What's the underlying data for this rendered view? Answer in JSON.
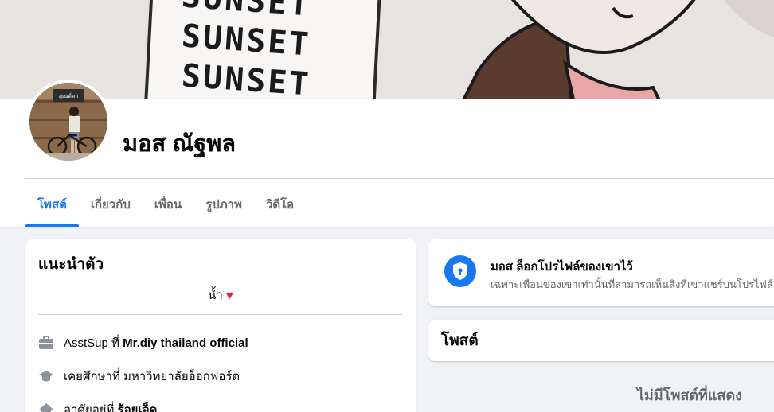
{
  "cover": {
    "words": [
      "SUNSET",
      "SUNSET",
      "SUNSET"
    ]
  },
  "profile": {
    "name": "มอส ณัฐพล",
    "avatar_sign": "สูเนต์ดา"
  },
  "tabs": [
    "โพสต์",
    "เกี่ยวกับ",
    "เพื่อน",
    "รูปภาพ",
    "วิดีโอ"
  ],
  "active_tab": "โพสต์",
  "intro": {
    "title": "แนะนำตัว",
    "bio": "น้ำ",
    "heart": "♥",
    "work": {
      "prefix": "AsstSup ที่ ",
      "place": "Mr.diy thailand official"
    },
    "education": {
      "prefix": "เคยศึกษาที่ ",
      "place": "มหาวิทยาลัยอ็อกฟอร์ด"
    },
    "lives": {
      "prefix": "อาศัยอยู่ที่ ",
      "place": "ร้อยเอ็ด"
    }
  },
  "locked": {
    "title": "มอส ล็อกโปรไฟล์ของเขาไว้",
    "subtitle": "เฉพาะเพื่อนของเขาเท่านั้นที่สามารถเห็นสิ่งที่เขาแชร์บนโปรไฟล์"
  },
  "posts": {
    "title": "โพสต์",
    "empty": "ไม่มีโพสต์ที่แสดง"
  },
  "colors": {
    "accent": "#1877f2",
    "heart": "#e41e3f",
    "muted": "#65676b"
  }
}
